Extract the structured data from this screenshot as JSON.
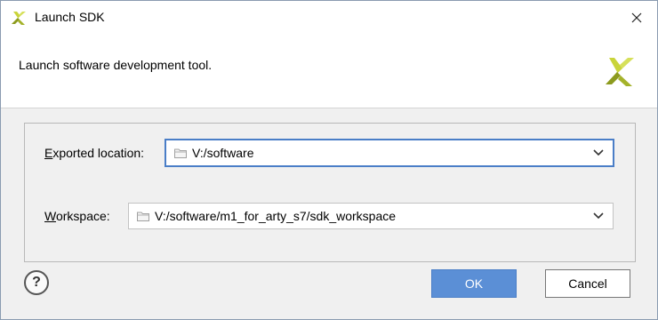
{
  "window": {
    "title": "Launch SDK"
  },
  "header": {
    "description": "Launch software development tool."
  },
  "form": {
    "exported_location": {
      "label_mnemonic": "E",
      "label_rest": "xported location:",
      "value": "V:/software"
    },
    "workspace": {
      "label_mnemonic": "W",
      "label_rest": "orkspace:",
      "value": "V:/software/m1_for_arty_s7/sdk_workspace"
    }
  },
  "footer": {
    "help_label": "?",
    "ok_label": "OK",
    "cancel_label": "Cancel"
  },
  "colors": {
    "logo_light": "#d6e05a",
    "logo_dark": "#8c9a1e",
    "accent_blue": "#5b8fd6",
    "focus_border": "#4a7ec7"
  },
  "icons": {
    "title_logo": "xilinx-logo-icon",
    "header_logo": "xilinx-logo-icon",
    "close": "close-icon",
    "folder": "folder-icon",
    "dropdown": "chevron-down-icon"
  }
}
